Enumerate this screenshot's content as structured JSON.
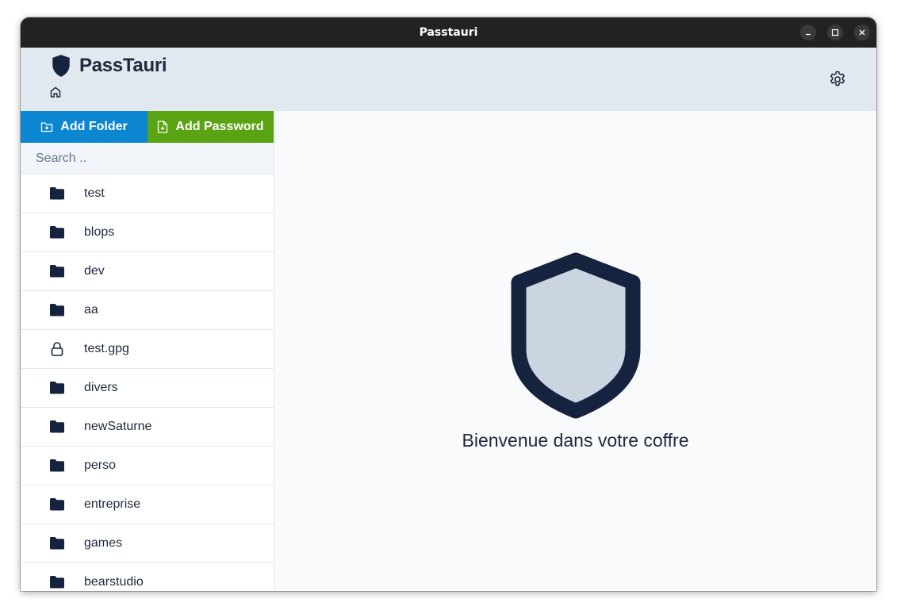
{
  "window": {
    "title": "Passtauri",
    "controls": [
      "minimize-icon",
      "maximize-icon",
      "close-icon"
    ]
  },
  "header": {
    "app_name": "PassTauri",
    "logo_icon": "shield-icon",
    "home_icon": "home-icon",
    "settings_icon": "gear-icon"
  },
  "sidebar": {
    "add_folder_label": "Add Folder",
    "add_password_label": "Add Password",
    "search_placeholder": "Search ..",
    "search_value": "",
    "items": [
      {
        "label": "test",
        "icon": "folder-icon"
      },
      {
        "label": "blops",
        "icon": "folder-icon"
      },
      {
        "label": "dev",
        "icon": "folder-icon"
      },
      {
        "label": "aa",
        "icon": "folder-icon"
      },
      {
        "label": "test.gpg",
        "icon": "lock-icon"
      },
      {
        "label": "divers",
        "icon": "folder-icon"
      },
      {
        "label": "newSaturne",
        "icon": "folder-icon"
      },
      {
        "label": "perso",
        "icon": "folder-icon"
      },
      {
        "label": "entreprise",
        "icon": "folder-icon"
      },
      {
        "label": "games",
        "icon": "folder-icon"
      },
      {
        "label": "bearstudio",
        "icon": "folder-icon"
      }
    ]
  },
  "main": {
    "welcome_text": "Bienvenue dans votre coffre",
    "hero_icon": "shield-icon"
  },
  "colors": {
    "titlebar": "#222222",
    "header_bg": "#e2e8f0",
    "add_folder_bg": "#0c86d0",
    "add_password_bg": "#5aa313",
    "icon_dark": "#16233f",
    "shield_fill": "#cbd5e1"
  }
}
